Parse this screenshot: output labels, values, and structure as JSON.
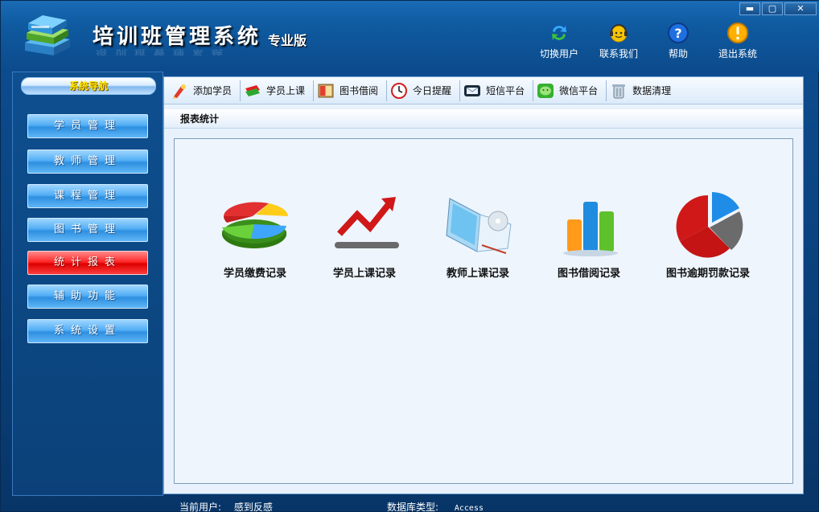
{
  "window": {
    "title": "培训班管理系统",
    "title_badge": "专业版",
    "title_reflection": "培训班管理系统",
    "controls": {
      "minimize": "▬",
      "maximize": "▢",
      "close": "✕"
    }
  },
  "top_actions": [
    {
      "label": "切换用户",
      "icon": "switch-user-icon"
    },
    {
      "label": "联系我们",
      "icon": "contact-icon"
    },
    {
      "label": "帮助",
      "icon": "help-icon"
    },
    {
      "label": "退出系统",
      "icon": "exit-icon"
    }
  ],
  "sidebar": {
    "header": "系统导航",
    "items": [
      {
        "label": "学员管理",
        "active": false
      },
      {
        "label": "教师管理",
        "active": false
      },
      {
        "label": "课程管理",
        "active": false
      },
      {
        "label": "图书管理",
        "active": false
      },
      {
        "label": "统计报表",
        "active": true
      },
      {
        "label": "辅助功能",
        "active": false
      },
      {
        "label": "系统设置",
        "active": false
      }
    ]
  },
  "toolbar": {
    "items": [
      {
        "label": "添加学员",
        "icon": "add-student-icon"
      },
      {
        "label": "学员上课",
        "icon": "student-class-icon"
      },
      {
        "label": "图书借阅",
        "icon": "book-borrow-icon"
      },
      {
        "label": "今日提醒",
        "icon": "clock-icon"
      },
      {
        "label": "短信平台",
        "icon": "sms-icon"
      },
      {
        "label": "微信平台",
        "icon": "wechat-icon"
      },
      {
        "label": "数据清理",
        "icon": "trash-icon"
      }
    ]
  },
  "section": {
    "title": "报表统计"
  },
  "reports": [
    {
      "label": "学员缴费记录",
      "icon": "pie-chart-icon"
    },
    {
      "label": "学员上课记录",
      "icon": "trend-arrow-icon"
    },
    {
      "label": "教师上课记录",
      "icon": "laptop-icon"
    },
    {
      "label": "图书借阅记录",
      "icon": "bar-chart-icon"
    },
    {
      "label": "图书逾期罚款记录",
      "icon": "donut-chart-icon"
    }
  ],
  "status": {
    "user_label": "当前用户:",
    "user_value": "感到反感",
    "db_label": "数据库类型:",
    "db_value": "Access"
  },
  "colors": {
    "frame": "#0b3f78",
    "nav_item": "#3a9ae8",
    "nav_active": "#ee1111",
    "panel_bg": "#eef5fd"
  }
}
